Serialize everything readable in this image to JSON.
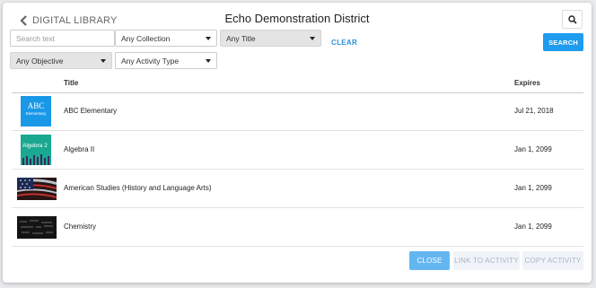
{
  "header": {
    "back_label": "DIGITAL LIBRARY",
    "title": "Echo Demonstration District"
  },
  "filters": {
    "search_placeholder": "Search text",
    "collection": "Any Collection",
    "title_filter": "Any Title",
    "clear_label": "CLEAR",
    "search_label": "SEARCH",
    "objective": "Any Objective",
    "activity_type": "Any Activity Type"
  },
  "table": {
    "columns": {
      "title": "Title",
      "expires": "Expires"
    },
    "rows": [
      {
        "title": "ABC Elementary",
        "expires": "Jul 21, 2018",
        "thumb_text": [
          "ABC",
          "Elementary"
        ]
      },
      {
        "title": "Algebra II",
        "expires": "Jan 1, 2099",
        "thumb_text": [
          "Algebra 2"
        ]
      },
      {
        "title": "American Studies (History and Language Arts)",
        "expires": "Jan 1, 2099"
      },
      {
        "title": "Chemistry",
        "expires": "Jan 1, 2099"
      }
    ]
  },
  "footer": {
    "close_label": "CLOSE",
    "link_label": "LINK TO ACTIVITY",
    "copy_label": "COPY ACTIVITY"
  },
  "colors": {
    "accent": "#1f9bf0",
    "close_button": "#64b6f1",
    "disabled_button": "#f0f4f8",
    "abc_thumb": "#1a98e8",
    "algebra_thumb": "#1aa891"
  },
  "icons": {
    "back": "chevron-left-icon",
    "search": "magnifier-icon",
    "dropdown": "caret-down-icon"
  }
}
